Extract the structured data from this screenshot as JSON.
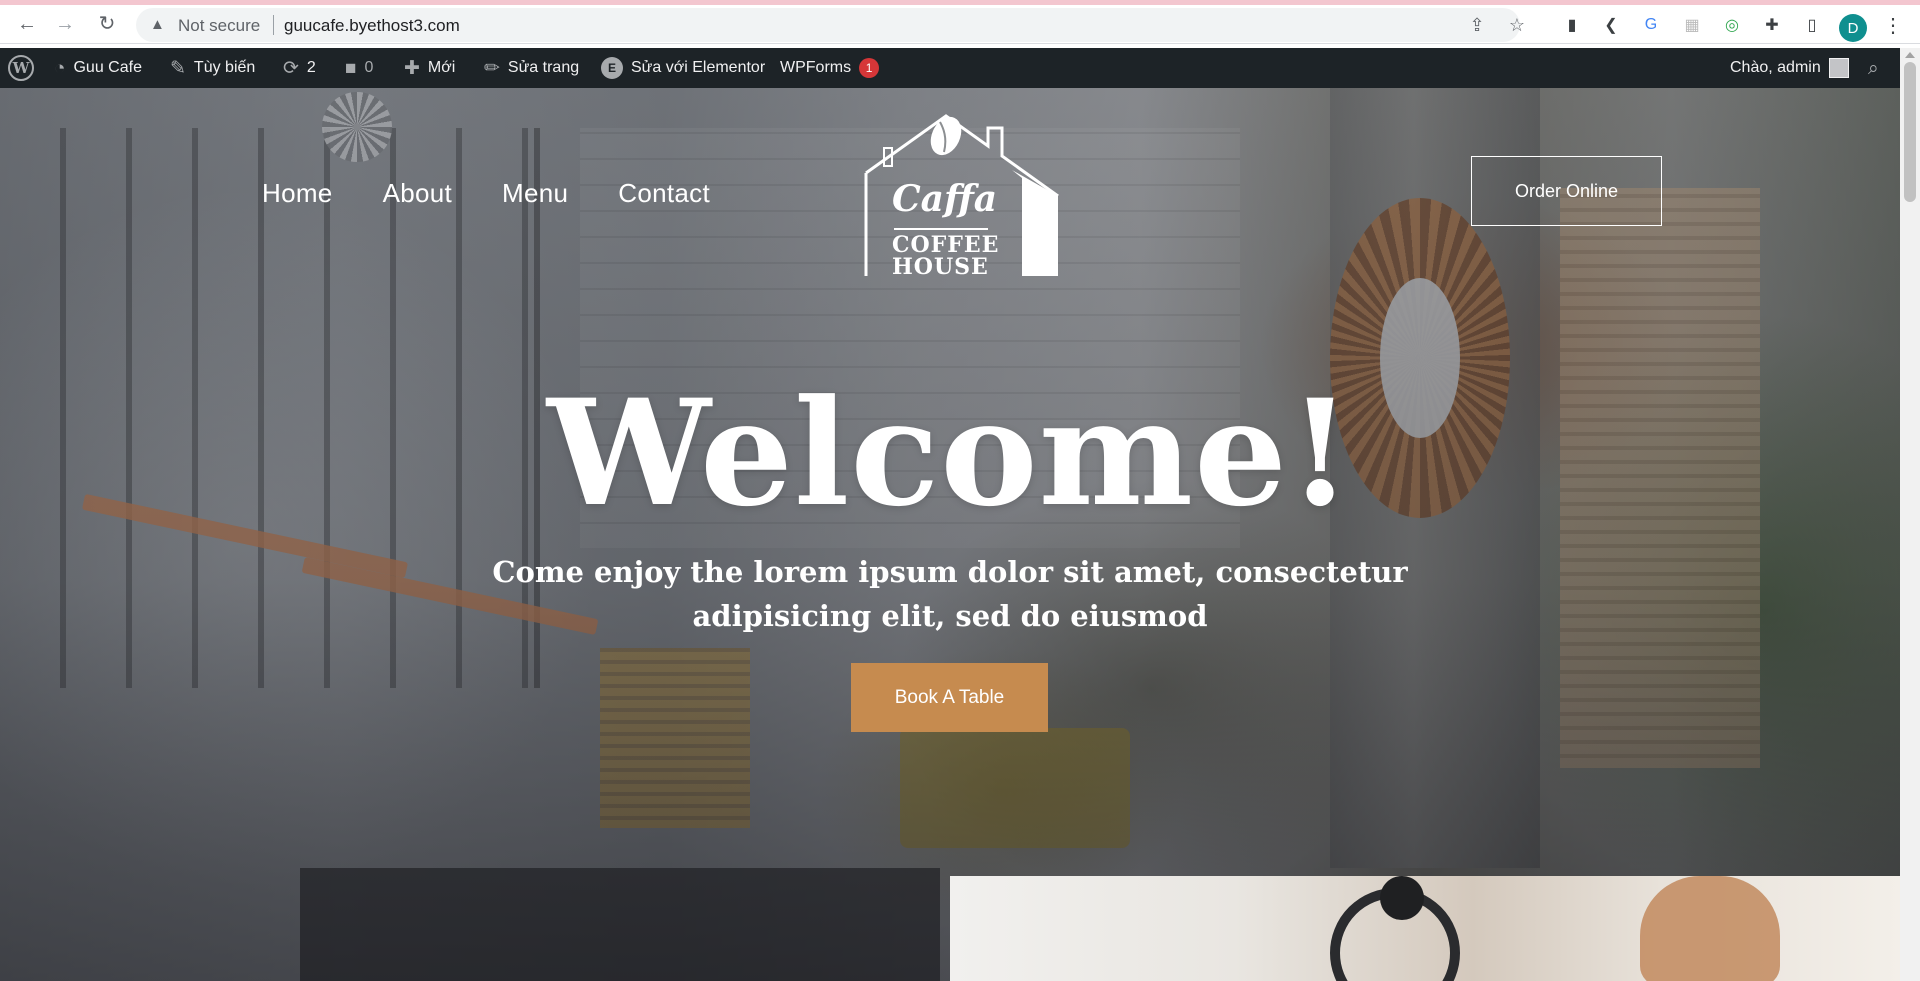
{
  "browser": {
    "security_label": "Not secure",
    "url": "guucafe.byethost3.com",
    "profile_initial": "D",
    "icons": {
      "back": "arrow-left",
      "forward": "arrow-right",
      "reload": "reload",
      "warning": "warning-triangle",
      "share": "share",
      "bookmark": "star",
      "extensions": "puzzle",
      "side_panel": "side-panel",
      "menu": "kebab-menu"
    }
  },
  "adminbar": {
    "site_name": "Guu Cafe",
    "customize": "Tùy biến",
    "updates_count": "2",
    "comments_count": "0",
    "new_label": "Mới",
    "edit_page": "Sửa trang",
    "elementor_label": "Sửa với Elementor",
    "elementor_badge": "E",
    "wpforms_label": "WPForms",
    "wpforms_count": "1",
    "greeting": "Chào, admin"
  },
  "site": {
    "nav": [
      "Home",
      "About",
      "Menu",
      "Contact"
    ],
    "logo": {
      "script": "Caffa",
      "line1": "COFFEE",
      "line2": "HOUSE"
    },
    "order_button": "Order Online",
    "hero_title": "Welcome!",
    "hero_tagline": "Come enjoy the lorem ipsum dolor sit amet, consectetur adipisicing elit, sed do eiusmod",
    "book_button": "Book A Table",
    "accent_color": "#c68b4f"
  },
  "colors": {
    "adminbar_bg": "#1d2327",
    "badge_red": "#d63638"
  }
}
